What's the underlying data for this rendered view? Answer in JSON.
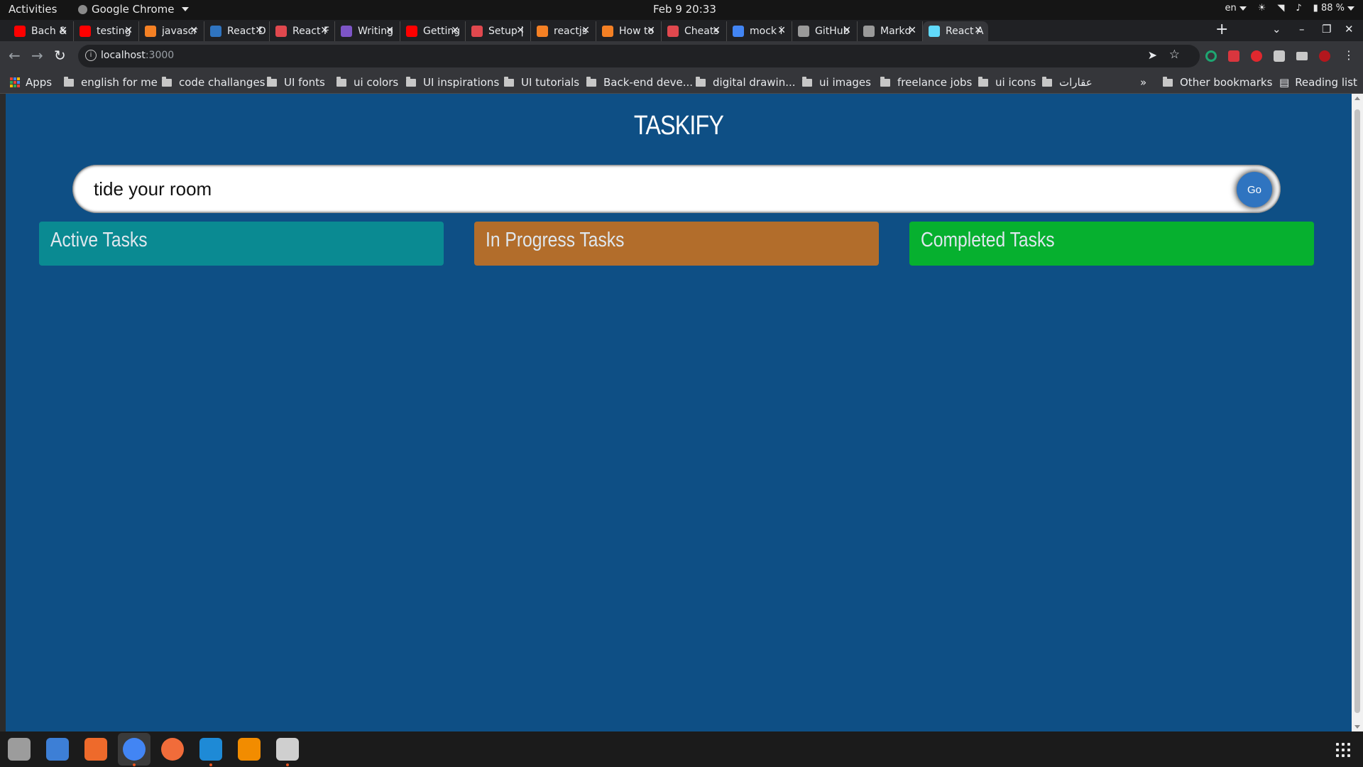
{
  "system": {
    "activities": "Activities",
    "app_menu": "Google Chrome",
    "clock": "Feb 9  20:33",
    "lang": "en",
    "battery": "88 %"
  },
  "tabs": [
    {
      "title": "Bach &",
      "icon": "youtube-icon",
      "color": "#ff0000"
    },
    {
      "title": "testing",
      "icon": "youtube-icon",
      "color": "#ff0000"
    },
    {
      "title": "javascr",
      "icon": "stackoverflow-icon",
      "color": "#f48024"
    },
    {
      "title": "React D",
      "icon": "site-icon",
      "color": "#2f74c0"
    },
    {
      "title": "React F",
      "icon": "octopus-icon",
      "color": "#e0484e"
    },
    {
      "title": "Writing",
      "icon": "atom-icon",
      "color": "#7d55c7"
    },
    {
      "title": "Getting",
      "icon": "youtube-icon",
      "color": "#ff0000"
    },
    {
      "title": "Setup |",
      "icon": "octopus-icon",
      "color": "#e0484e"
    },
    {
      "title": "reactjs",
      "icon": "stackoverflow-icon",
      "color": "#f48024"
    },
    {
      "title": "How to",
      "icon": "stackoverflow-icon",
      "color": "#f48024"
    },
    {
      "title": "Cheats",
      "icon": "octopus-icon",
      "color": "#e0484e"
    },
    {
      "title": "mock i",
      "icon": "google-icon",
      "color": "#4285f4"
    },
    {
      "title": "GitHub",
      "icon": "github-icon",
      "color": "#9a9a9a"
    },
    {
      "title": "Markd",
      "icon": "github-icon",
      "color": "#9a9a9a"
    },
    {
      "title": "React A",
      "icon": "react-icon",
      "color": "#61dafb"
    }
  ],
  "toolbar": {
    "url_host": "localhost",
    "url_port": ":3000"
  },
  "bookmarks": {
    "apps": "Apps",
    "items": [
      "english for me",
      "code challanges",
      "UI fonts",
      "ui colors",
      "UI inspirations",
      "UI tutorials",
      "Back-end deve...",
      "digital drawin...",
      "ui images",
      "freelance jobs",
      "ui icons",
      "عقارات"
    ],
    "other": "Other bookmarks",
    "reading_list": "Reading list"
  },
  "app": {
    "heading": "TASKIFY",
    "input_value": "tide your room",
    "go_label": "Go",
    "columns": {
      "active": "Active Tasks",
      "in_progress": "In Progress Tasks",
      "completed": "Completed Tasks"
    },
    "colors": {
      "background": "#0e4f85",
      "active": "#0a8a92",
      "in_progress": "#b26d2b",
      "completed": "#06b02f",
      "go": "#2f74c0"
    }
  },
  "dock": {
    "apps": [
      "files-icon",
      "text-editor-icon",
      "software-center-icon",
      "chrome-icon",
      "postman-icon",
      "vscode-icon",
      "vlc-icon",
      "screenshot-icon"
    ]
  }
}
